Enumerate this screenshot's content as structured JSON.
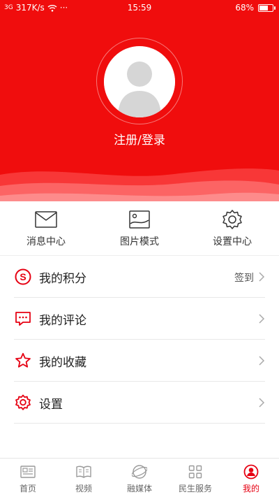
{
  "status_bar": {
    "signal": "3G",
    "speed": "317K/s",
    "more": "···",
    "time": "15:59",
    "battery": "68%",
    "battery_level": 0.68
  },
  "profile": {
    "login_text": "注册/登录"
  },
  "quick_actions": [
    {
      "label": "消息中心",
      "icon": "envelope-icon"
    },
    {
      "label": "图片模式",
      "icon": "picture-icon"
    },
    {
      "label": "设置中心",
      "icon": "gear-icon"
    }
  ],
  "menu": [
    {
      "label": "我的积分",
      "extra": "签到",
      "icon": "points-icon"
    },
    {
      "label": "我的评论",
      "extra": "",
      "icon": "comment-icon"
    },
    {
      "label": "我的收藏",
      "extra": "",
      "icon": "star-icon"
    },
    {
      "label": "设置",
      "extra": "",
      "icon": "settings-icon"
    }
  ],
  "tabs": [
    {
      "label": "首页",
      "icon": "news-icon",
      "active": false
    },
    {
      "label": "视频",
      "icon": "book-icon",
      "active": false
    },
    {
      "label": "融媒体",
      "icon": "globe-icon",
      "active": false
    },
    {
      "label": "民生服务",
      "icon": "grid-icon",
      "active": false
    },
    {
      "label": "我的",
      "icon": "profile-icon",
      "active": true
    }
  ],
  "colors": {
    "brand_red": "#f00d0d",
    "accent_red": "#e60012",
    "icon_gray": "#999999"
  }
}
